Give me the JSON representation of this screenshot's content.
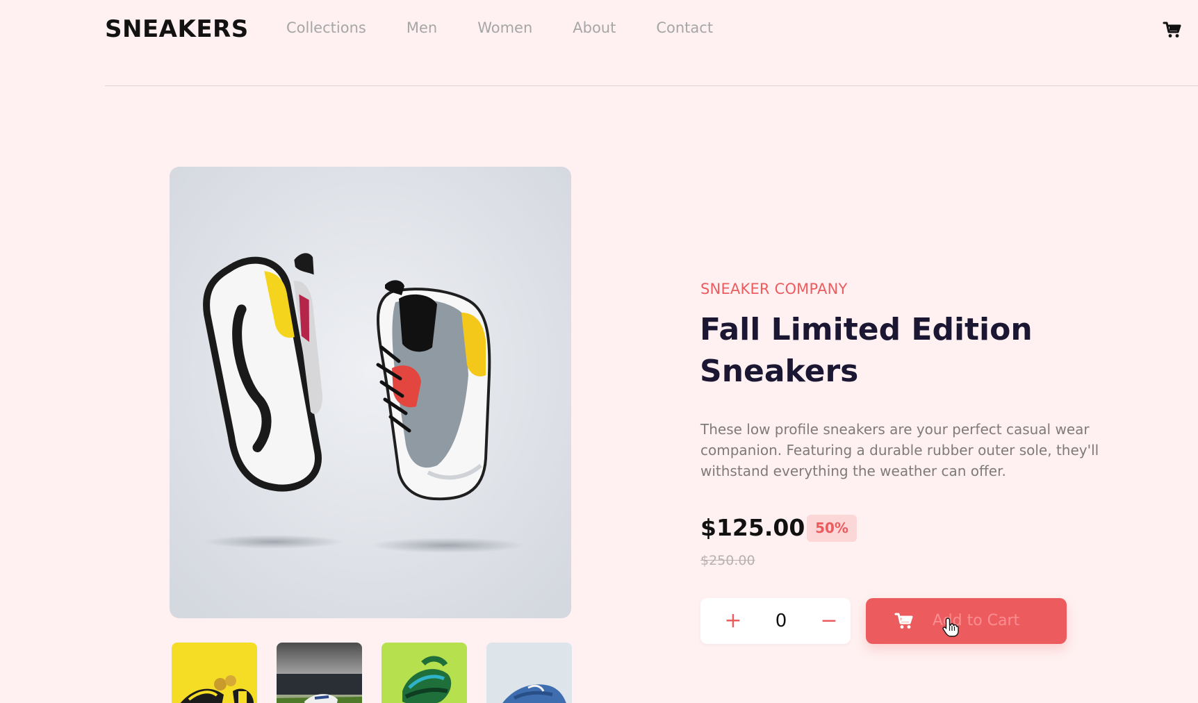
{
  "header": {
    "brand": "SNEAKERS",
    "nav": [
      "Collections",
      "Men",
      "Women",
      "About",
      "Contact"
    ],
    "cart_icon": "cart-icon"
  },
  "product": {
    "company": "SNEAKER COMPANY",
    "title": "Fall Limited Edition Sneakers",
    "description": "These low profile sneakers are your perfect casual wear companion. Featuring a durable rubber outer sole, they'll withstand everything the weather can offer.",
    "price": "$125.00",
    "discount": "50%",
    "old_price": "$250.00",
    "quantity": "0",
    "plus_label": "+",
    "minus_label": "−",
    "add_to_cart_label": "Add to Cart"
  },
  "colors": {
    "background": "#fff1f1",
    "accent": "#ec5c5f",
    "discount_bg": "#fbd7d8",
    "title": "#1b1733",
    "nav_text": "#a6a6a6"
  }
}
